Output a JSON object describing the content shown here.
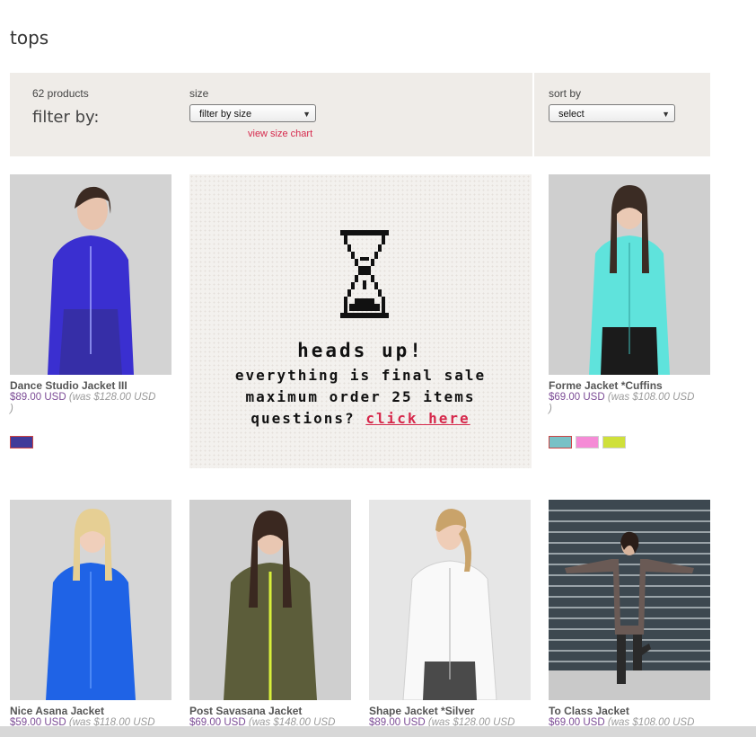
{
  "page": {
    "title": "tops"
  },
  "filters": {
    "product_count": "62 products",
    "filter_by_label": "filter by:",
    "size_label": "size",
    "size_select_value": "filter by size",
    "size_chart_link": "view size chart",
    "sort_label": "sort by",
    "sort_select_value": "select"
  },
  "promo": {
    "heading": "Heads up!",
    "line1": "Everything is final sale",
    "line2": "Maximum order 25 items",
    "line3_prefix": "Questions?",
    "line3_link": "Click here"
  },
  "products": [
    {
      "name": "Dance Studio Jacket III",
      "price": "$89.00 USD",
      "was": "(was $128.00 USD",
      "was_close": ")",
      "color": "#3a2fd0",
      "swatches": [
        "#403a99"
      ]
    },
    {
      "name": "Forme Jacket *Cuffins",
      "price": "$69.00 USD",
      "was": "(was $108.00 USD",
      "was_close": ")",
      "color": "#5fe3dc",
      "swatches": [
        "#79c1c6",
        "#f58bd6",
        "#cfe03a"
      ]
    },
    {
      "name": "Nice Asana Jacket",
      "price": "$59.00 USD",
      "was": "(was $118.00 USD",
      "was_close": "",
      "color": "#1f63e6",
      "swatches": []
    },
    {
      "name": "Post Savasana Jacket",
      "price": "$69.00 USD",
      "was": "(was $148.00 USD",
      "was_close": "",
      "color": "#5c5d3a",
      "swatches": []
    },
    {
      "name": "Shape Jacket *Silver",
      "price": "$89.00 USD",
      "was": "(was $128.00 USD",
      "was_close": "",
      "color": "#f4f4f4",
      "swatches": []
    },
    {
      "name": "To Class Jacket",
      "price": "$69.00 USD",
      "was": "(was $108.00 USD",
      "was_close": "",
      "color": "#6a5a55",
      "swatches": []
    }
  ]
}
